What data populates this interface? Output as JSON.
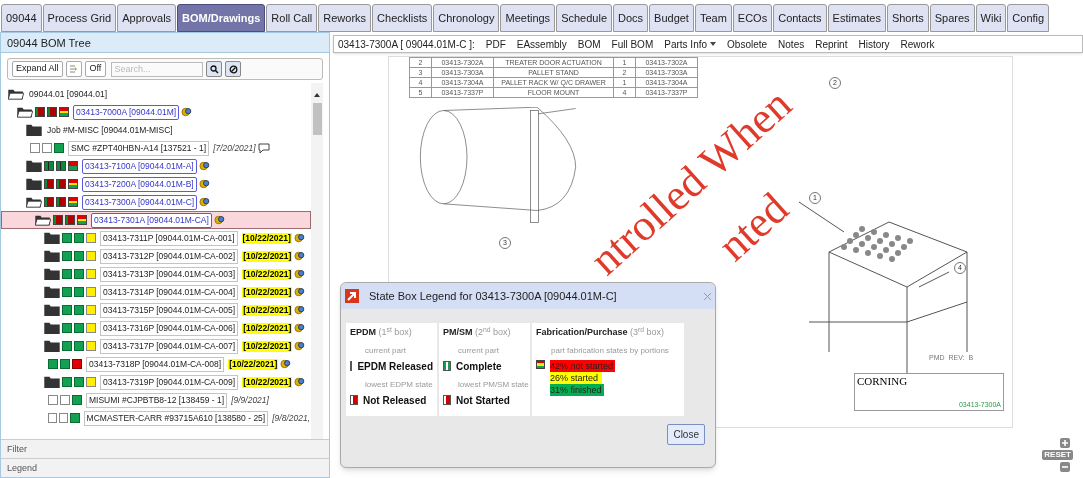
{
  "tabs": [
    {
      "label": "09044",
      "selected": false
    },
    {
      "label": "Process Grid",
      "selected": false
    },
    {
      "label": "Approvals",
      "selected": false
    },
    {
      "label": "BOM/Drawings",
      "selected": true
    },
    {
      "label": "Roll Call",
      "selected": false
    },
    {
      "label": "Reworks",
      "selected": false
    },
    {
      "label": "Checklists",
      "selected": false
    },
    {
      "label": "Chronology",
      "selected": false
    },
    {
      "label": "Meetings",
      "selected": false
    },
    {
      "label": "Schedule",
      "selected": false
    },
    {
      "label": "Docs",
      "selected": false
    },
    {
      "label": "Budget",
      "selected": false
    },
    {
      "label": "Team",
      "selected": false
    },
    {
      "label": "ECOs",
      "selected": false
    },
    {
      "label": "Contacts",
      "selected": false
    },
    {
      "label": "Estimates",
      "selected": false
    },
    {
      "label": "Shorts",
      "selected": false
    },
    {
      "label": "Spares",
      "selected": false
    },
    {
      "label": "Wiki",
      "selected": false
    },
    {
      "label": "Config",
      "selected": false
    }
  ],
  "left_panel": {
    "title": "09044 BOM Tree",
    "expand_button": "Expand All",
    "off_button": "Off",
    "search": {
      "placeholder": "Search..."
    },
    "tree": [
      {
        "kind": "folder",
        "expanded": true,
        "selected": false,
        "label": "09044.01 [09044.01]",
        "link": false,
        "bordered": false,
        "children": [
          {
            "kind": "folder",
            "expanded": true,
            "selected": false,
            "boxes": [
              {
                "kind": "redstripe"
              },
              {
                "kind": "redstripe"
              },
              {
                "kind": "tricolor"
              }
            ],
            "label": "03413-7000A [09044.01M]",
            "link": true,
            "children": [
              {
                "kind": "folder",
                "expanded": false,
                "selected": false,
                "label": "Job #M-MISC [09044.01M-MISC]",
                "link": false,
                "bordered": false
              },
              {
                "kind": "part",
                "selected": false,
                "boxes": [
                  {
                    "kind": "empty"
                  },
                  {
                    "kind": "empty"
                  },
                  {
                    "kind": "green"
                  }
                ],
                "label": "SMC #ZPT40HBN-A14 [137521 - 1]",
                "link": false,
                "bordered": true,
                "date": "[7/20/2021]",
                "highlighted": false,
                "has_comment": true
              },
              {
                "kind": "folder",
                "expanded": false,
                "selected": false,
                "boxes": [
                  {
                    "kind": "greenstripe"
                  },
                  {
                    "kind": "greenstripe"
                  },
                  {
                    "kind": "redgreen"
                  }
                ],
                "label": "03413-7100A [09044.01M-A]",
                "link": true
              },
              {
                "kind": "folder",
                "expanded": false,
                "selected": false,
                "boxes": [
                  {
                    "kind": "redstripe"
                  },
                  {
                    "kind": "redstripe"
                  },
                  {
                    "kind": "tricolor"
                  }
                ],
                "label": "03413-7200A [09044.01M-B]",
                "link": true
              },
              {
                "kind": "folder",
                "expanded": true,
                "selected": false,
                "boxes": [
                  {
                    "kind": "redstripe"
                  },
                  {
                    "kind": "redstripe"
                  },
                  {
                    "kind": "tricolor"
                  }
                ],
                "label": "03413-7300A [09044.01M-C]",
                "link": true,
                "children": [
                  {
                    "kind": "folder",
                    "expanded": true,
                    "selected": true,
                    "boxes": [
                      {
                        "kind": "redstripe"
                      },
                      {
                        "kind": "redstripe"
                      },
                      {
                        "kind": "tricolor"
                      }
                    ],
                    "label": "03413-7301A [09044.01M-CA]",
                    "link": true,
                    "children": [
                      {
                        "kind": "folder",
                        "expanded": false,
                        "selected": false,
                        "boxes": [
                          {
                            "kind": "green"
                          },
                          {
                            "kind": "green"
                          },
                          {
                            "kind": "yellow"
                          }
                        ],
                        "label": "03413-7311P [09044.01M-CA-001]",
                        "link": false,
                        "bordered": true,
                        "date": "[10/22/2021]",
                        "highlighted": true
                      },
                      {
                        "kind": "folder",
                        "expanded": false,
                        "selected": false,
                        "boxes": [
                          {
                            "kind": "green"
                          },
                          {
                            "kind": "green"
                          },
                          {
                            "kind": "yellow"
                          }
                        ],
                        "label": "03413-7312P [09044.01M-CA-002]",
                        "link": false,
                        "bordered": true,
                        "date": "[10/22/2021]",
                        "highlighted": true
                      },
                      {
                        "kind": "folder",
                        "expanded": false,
                        "selected": false,
                        "boxes": [
                          {
                            "kind": "green"
                          },
                          {
                            "kind": "green"
                          },
                          {
                            "kind": "yellow"
                          }
                        ],
                        "label": "03413-7313P [09044.01M-CA-003]",
                        "link": false,
                        "bordered": true,
                        "date": "[10/22/2021]",
                        "highlighted": true
                      },
                      {
                        "kind": "folder",
                        "expanded": false,
                        "selected": false,
                        "boxes": [
                          {
                            "kind": "green"
                          },
                          {
                            "kind": "green"
                          },
                          {
                            "kind": "yellow"
                          }
                        ],
                        "label": "03413-7314P [09044.01M-CA-004]",
                        "link": false,
                        "bordered": true,
                        "date": "[10/22/2021]",
                        "highlighted": true
                      },
                      {
                        "kind": "folder",
                        "expanded": false,
                        "selected": false,
                        "boxes": [
                          {
                            "kind": "green"
                          },
                          {
                            "kind": "green"
                          },
                          {
                            "kind": "yellow"
                          }
                        ],
                        "label": "03413-7315P [09044.01M-CA-005]",
                        "link": false,
                        "bordered": true,
                        "date": "[10/22/2021]",
                        "highlighted": true
                      },
                      {
                        "kind": "folder",
                        "expanded": false,
                        "selected": false,
                        "boxes": [
                          {
                            "kind": "green"
                          },
                          {
                            "kind": "green"
                          },
                          {
                            "kind": "yellow"
                          }
                        ],
                        "label": "03413-7316P [09044.01M-CA-006]",
                        "link": false,
                        "bordered": true,
                        "date": "[10/22/2021]",
                        "highlighted": true
                      },
                      {
                        "kind": "folder",
                        "expanded": false,
                        "selected": false,
                        "boxes": [
                          {
                            "kind": "green"
                          },
                          {
                            "kind": "green"
                          },
                          {
                            "kind": "yellow"
                          }
                        ],
                        "label": "03413-7317P [09044.01M-CA-007]",
                        "link": false,
                        "bordered": true,
                        "date": "[10/22/2021]",
                        "highlighted": true
                      },
                      {
                        "kind": "part",
                        "selected": false,
                        "boxes": [
                          {
                            "kind": "green"
                          },
                          {
                            "kind": "green"
                          },
                          {
                            "kind": "red"
                          }
                        ],
                        "label": "03413-7318P [09044.01M-CA-008]",
                        "link": false,
                        "bordered": true,
                        "date": "[10/22/2021]",
                        "highlighted": true
                      },
                      {
                        "kind": "folder",
                        "expanded": false,
                        "selected": false,
                        "boxes": [
                          {
                            "kind": "green"
                          },
                          {
                            "kind": "green"
                          },
                          {
                            "kind": "yellow"
                          }
                        ],
                        "label": "03413-7319P [09044.01M-CA-009]",
                        "link": false,
                        "bordered": true,
                        "date": "[10/22/2021]",
                        "highlighted": true
                      },
                      {
                        "kind": "part",
                        "selected": false,
                        "boxes": [
                          {
                            "kind": "empty"
                          },
                          {
                            "kind": "empty"
                          },
                          {
                            "kind": "green"
                          }
                        ],
                        "label": "MISUMI #CJPBTB8-12 [138459 - 1]",
                        "link": false,
                        "bordered": true,
                        "date": "[9/9/2021]",
                        "highlighted": false
                      },
                      {
                        "kind": "part",
                        "selected": false,
                        "boxes": [
                          {
                            "kind": "empty"
                          },
                          {
                            "kind": "empty"
                          },
                          {
                            "kind": "green"
                          }
                        ],
                        "label": "MCMASTER-CARR #93715A610 [138580 - 25]",
                        "link": false,
                        "bordered": true,
                        "date": "[9/8/2021,",
                        "highlighted": false
                      }
                    ]
                  }
                ]
              }
            ]
          }
        ]
      }
    ],
    "sections": [
      "Filter",
      "Legend"
    ]
  },
  "viewer": {
    "title": "03413-7300A [ 09044.01M-C ]:",
    "menu": [
      {
        "label": "PDF",
        "kind": "link"
      },
      {
        "label": "EAssembly",
        "kind": "link"
      },
      {
        "label": "BOM",
        "kind": "link"
      },
      {
        "label": "Full BOM",
        "kind": "link"
      },
      {
        "label": "Parts Info",
        "kind": "dropdown"
      },
      {
        "label": "Obsolete",
        "kind": "link"
      },
      {
        "label": "Notes",
        "kind": "link"
      },
      {
        "label": "Reprint",
        "kind": "link"
      },
      {
        "label": "History",
        "kind": "link"
      },
      {
        "label": "Rework",
        "kind": "link"
      }
    ],
    "drawing": {
      "bom_rows": [
        [
          "2",
          "03413-7302A",
          "TREATER DOOR ACTUATION",
          "1",
          "03413-7302A"
        ],
        [
          "3",
          "03413-7303A",
          "PALLET STAND",
          "2",
          "03413-7303A"
        ],
        [
          "4",
          "03413-7304A",
          "PALLET RACK W/ Q/C DRAWER",
          "1",
          "03413-7304A"
        ],
        [
          "5",
          "03413-7337P",
          "FLOOR MOUNT",
          "4",
          "03413-7337P"
        ]
      ],
      "balloons": [
        "2",
        "3",
        "1",
        "4"
      ],
      "stamp": [
        "ntrolled When",
        "nted"
      ],
      "revision": "PMD  REV:  B",
      "company": "CORNING",
      "drawing_number": "03413-7300A"
    },
    "zoom": {
      "reset": "RESET"
    }
  },
  "dialog": {
    "title": "State Box Legend for 03413-7300A [09044.01M-C]",
    "close_button": "Close",
    "sections": [
      {
        "kind": "states",
        "title": "EPDM",
        "note": "(1$^{st}$ box)",
        "entries": [
          {
            "caption": "current part",
            "box": {
              "kind": "released"
            },
            "label": "EPDM Released"
          },
          {
            "caption": "lowest EDPM state",
            "box": {
              "kind": "notreleased"
            },
            "label": "Not Released"
          }
        ]
      },
      {
        "kind": "states",
        "title": "PM/SM",
        "note": "(2$^{nd}$ box)",
        "entries": [
          {
            "caption": "current part",
            "box": {
              "kind": "released"
            },
            "label": "Complete"
          },
          {
            "caption": "lowest PM/SM state",
            "box": {
              "kind": "notreleased"
            },
            "label": "Not Started"
          }
        ]
      },
      {
        "kind": "portions",
        "title": "Fabrication/Purchase",
        "note": "(3$^{rd}$ box)",
        "caption": "part fabrication states by portions",
        "box": {
          "kind": "tricolor"
        },
        "portions": [
          {
            "label": "42% not started",
            "color": "#ff0000"
          },
          {
            "label": "26% started",
            "color": "#ffff00"
          },
          {
            "label": "31% finished",
            "color": "#00b050"
          }
        ]
      }
    ]
  }
}
